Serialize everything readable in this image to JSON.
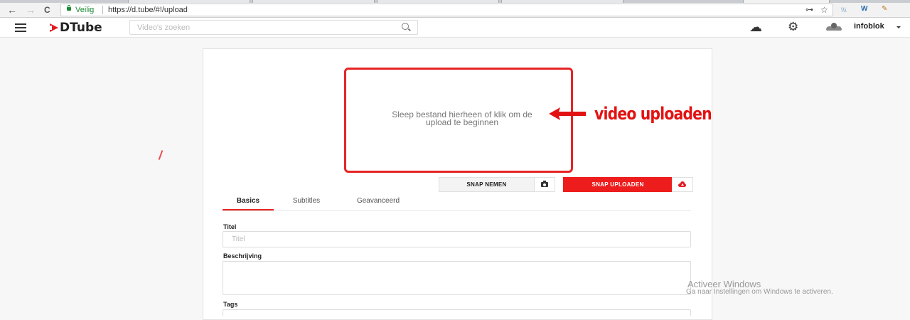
{
  "browser": {
    "back_icon": "←",
    "forward_icon": "→",
    "reload_icon": "C",
    "secure_label": "Veilig",
    "url": "https://d.tube/#!/upload",
    "key_icon": "⊶",
    "star_icon": "☆",
    "extensions": [
      "\\\\\\",
      "W",
      "✎"
    ]
  },
  "header": {
    "logo_text": "DTube",
    "search_placeholder": "Video's zoeken",
    "upload_icon": "☁",
    "settings_icon": "⚙",
    "username": "infoblok"
  },
  "upload": {
    "dropzone_line1": "Sleep bestand hierheen of klik om de",
    "dropzone_line2": "upload te beginnen",
    "annotation": "video uploaden",
    "snap_take_label": "SNAP NEMEN",
    "snap_upload_label": "SNAP UPLOADEN"
  },
  "tabs": [
    {
      "label": "Basics",
      "active": true
    },
    {
      "label": "Subtitles",
      "active": false
    },
    {
      "label": "Geavanceerd",
      "active": false
    }
  ],
  "form": {
    "title_label": "Titel",
    "title_placeholder": "Titel",
    "description_label": "Beschrijving",
    "tags_label": "Tags"
  },
  "watermark": {
    "title": "Activeer Windows",
    "subtitle": "Ga naar Instellingen om Windows te activeren."
  },
  "colors": {
    "accent": "#e52424",
    "brand": "#e31b23",
    "secure": "#1a8a32"
  }
}
